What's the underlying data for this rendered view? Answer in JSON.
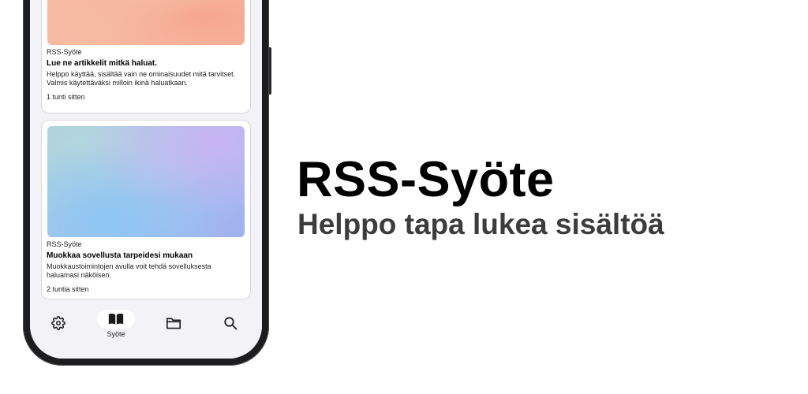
{
  "hero": {
    "title": "RSS-Syöte",
    "subtitle": "Helppo tapa lukea sisältöä"
  },
  "feed": {
    "items": [
      {
        "source": "RSS-Syöte",
        "title": "Lue ne artikkelit mitkä haluat.",
        "body": "Helppo käyttää, sisältää vain ne ominaisuudet mitä tarvitset. Valmis käytettäväksi milloin ikinä haluatkaan.",
        "time": "1 tunti sitten",
        "image_colors": [
          "#f3cdb5",
          "#f6b7a0"
        ]
      },
      {
        "source": "RSS-Syöte",
        "title": "Muokkaa sovellusta tarpeidesi mukaan",
        "body": "Muokkaustoimintojen avulla voit tehdä sovelluksesta haluamasi näköisen.",
        "time": "2 tuntia sitten",
        "image_colors": [
          "#aad3dd",
          "#9fb0f0"
        ]
      }
    ]
  },
  "bottom_nav": {
    "items": [
      {
        "icon": "gear-icon",
        "label": ""
      },
      {
        "icon": "book-icon",
        "label": "Syöte",
        "active": true
      },
      {
        "icon": "folder-icon",
        "label": ""
      },
      {
        "icon": "search-icon",
        "label": ""
      }
    ]
  },
  "colors": {
    "screen_background": "#f3f2f7",
    "phone_frame": "#1d1d1f",
    "card_background": "#ffffff",
    "hero_title": "#000000",
    "hero_subtitle": "#3c3c3c"
  }
}
